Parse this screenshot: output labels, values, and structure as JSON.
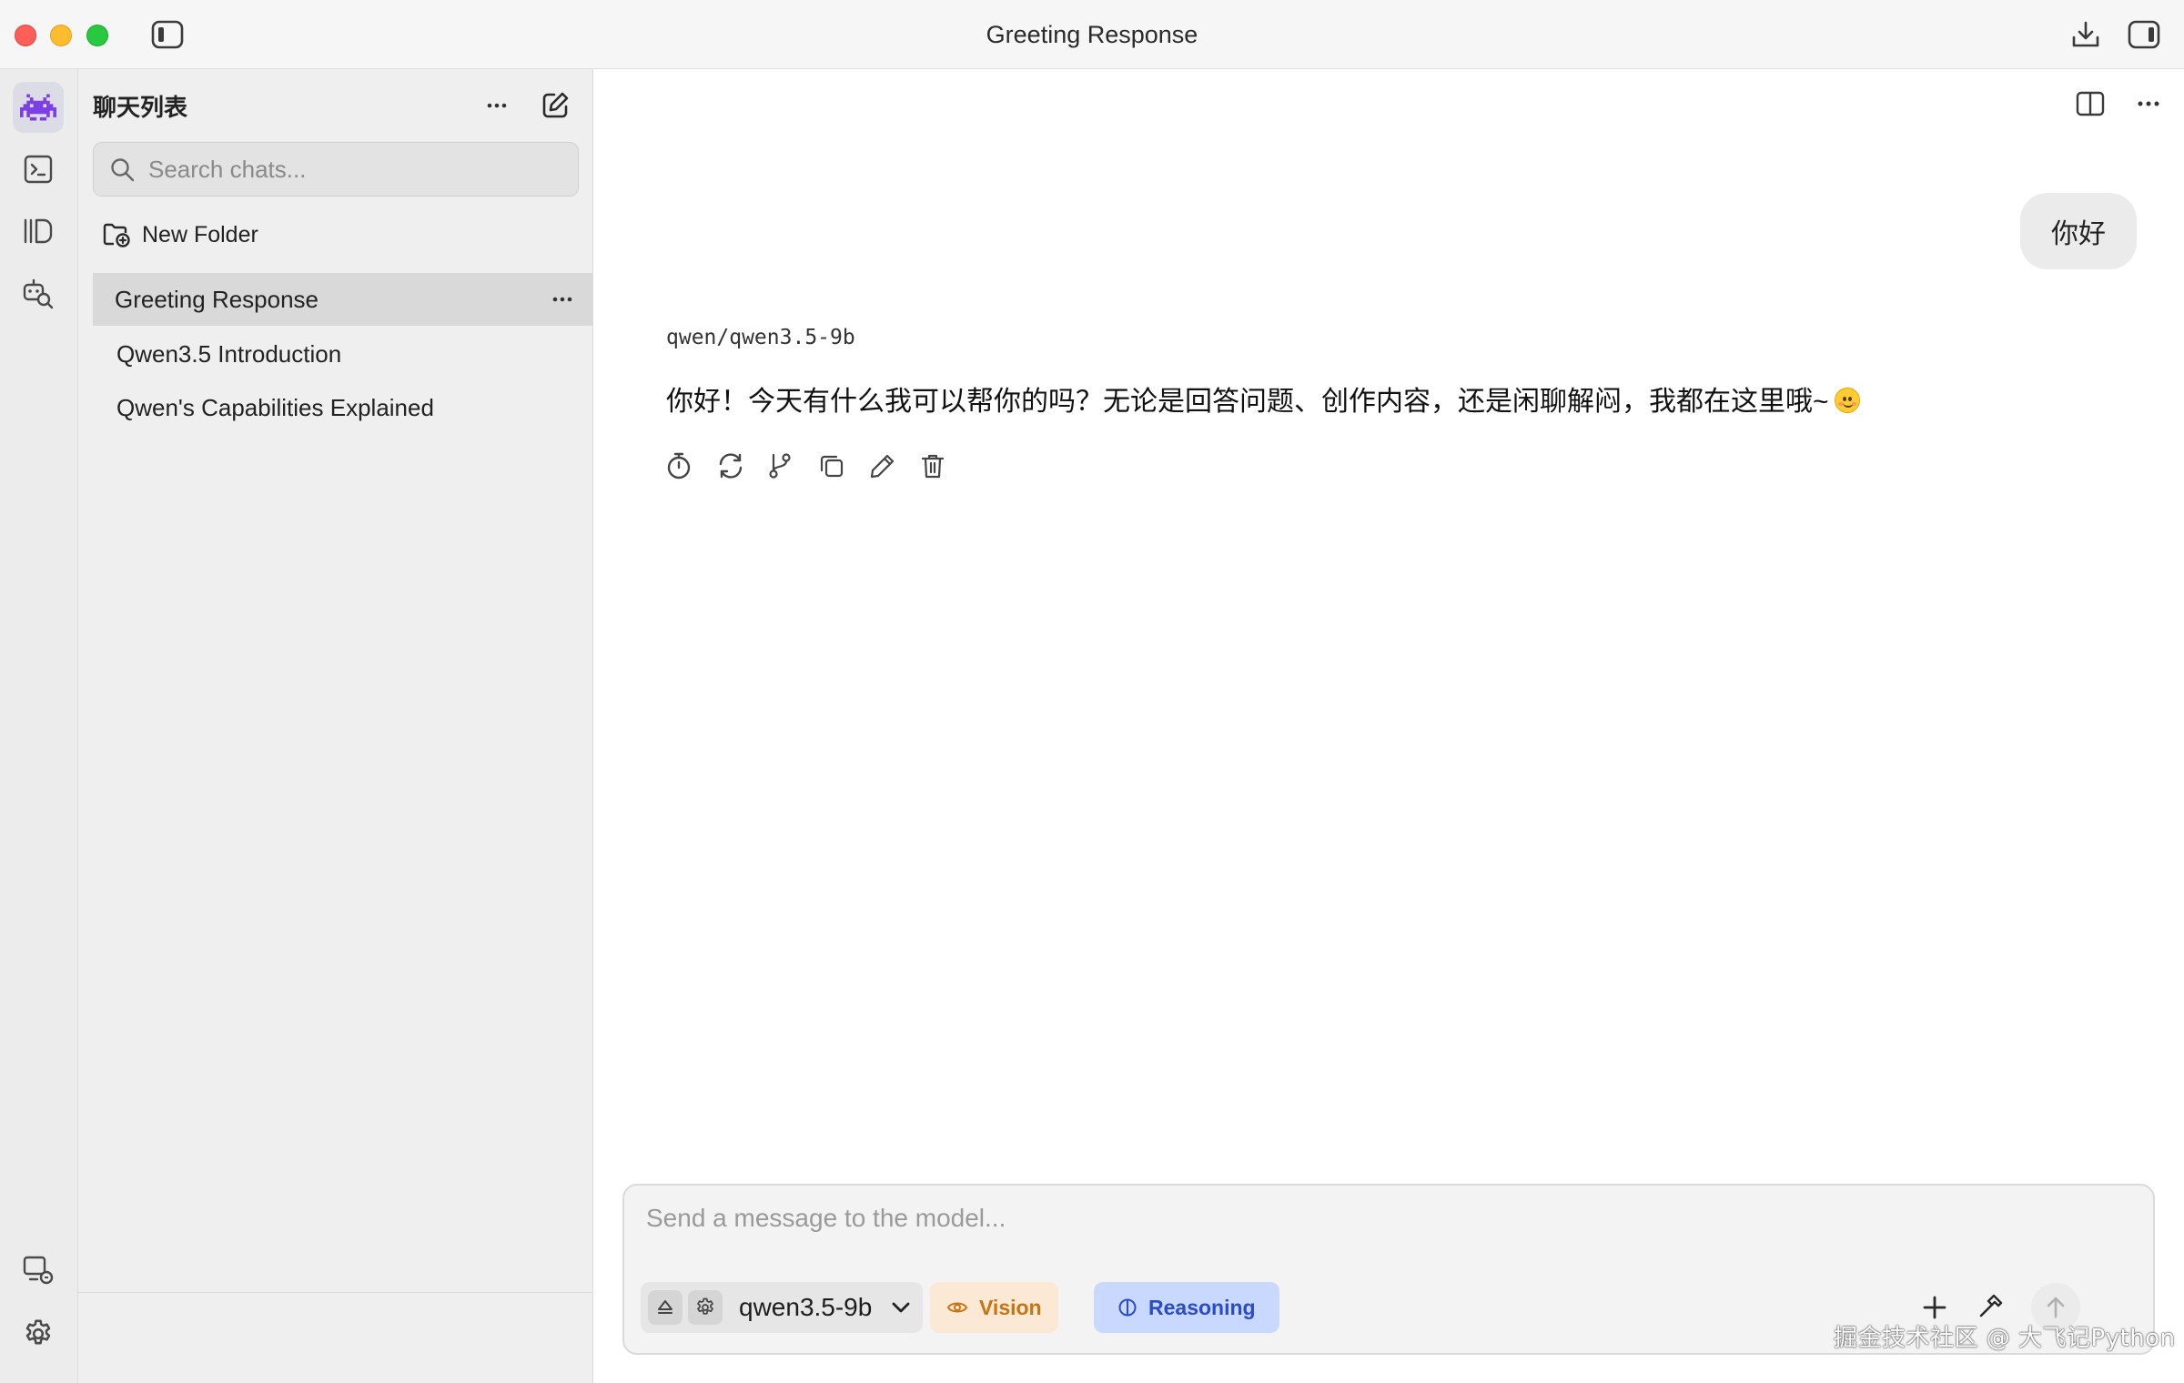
{
  "window": {
    "title": "Greeting Response"
  },
  "sidebar": {
    "title": "聊天列表",
    "search_placeholder": "Search chats...",
    "new_folder_label": "New Folder",
    "chats": [
      {
        "title": "Greeting Response",
        "selected": true
      },
      {
        "title": "Qwen3.5 Introduction",
        "selected": false
      },
      {
        "title": "Qwen's Capabilities Explained",
        "selected": false
      }
    ]
  },
  "conversation": {
    "user_message": "你好",
    "assistant_model": "qwen/qwen3.5-9b",
    "assistant_message": "你好！今天有什么我可以帮你的吗？无论是回答问题、创作内容，还是闲聊解闷，我都在这里哦~",
    "assistant_emoji": "smiling-face-emoji"
  },
  "composer": {
    "placeholder": "Send a message to the model...",
    "model_label": "qwen3.5-9b",
    "vision_label": "Vision",
    "reasoning_label": "Reasoning"
  },
  "watermark": "掘金技术社区 @ 大飞记Python",
  "colors": {
    "accent_purple": "#7b3fe4",
    "vision_text": "#c77413",
    "vision_bg": "#fbe9d6",
    "reasoning_text": "#2b4cc4",
    "reasoning_bg": "#c9d8ff",
    "selected_row": "#d9d9d9"
  }
}
